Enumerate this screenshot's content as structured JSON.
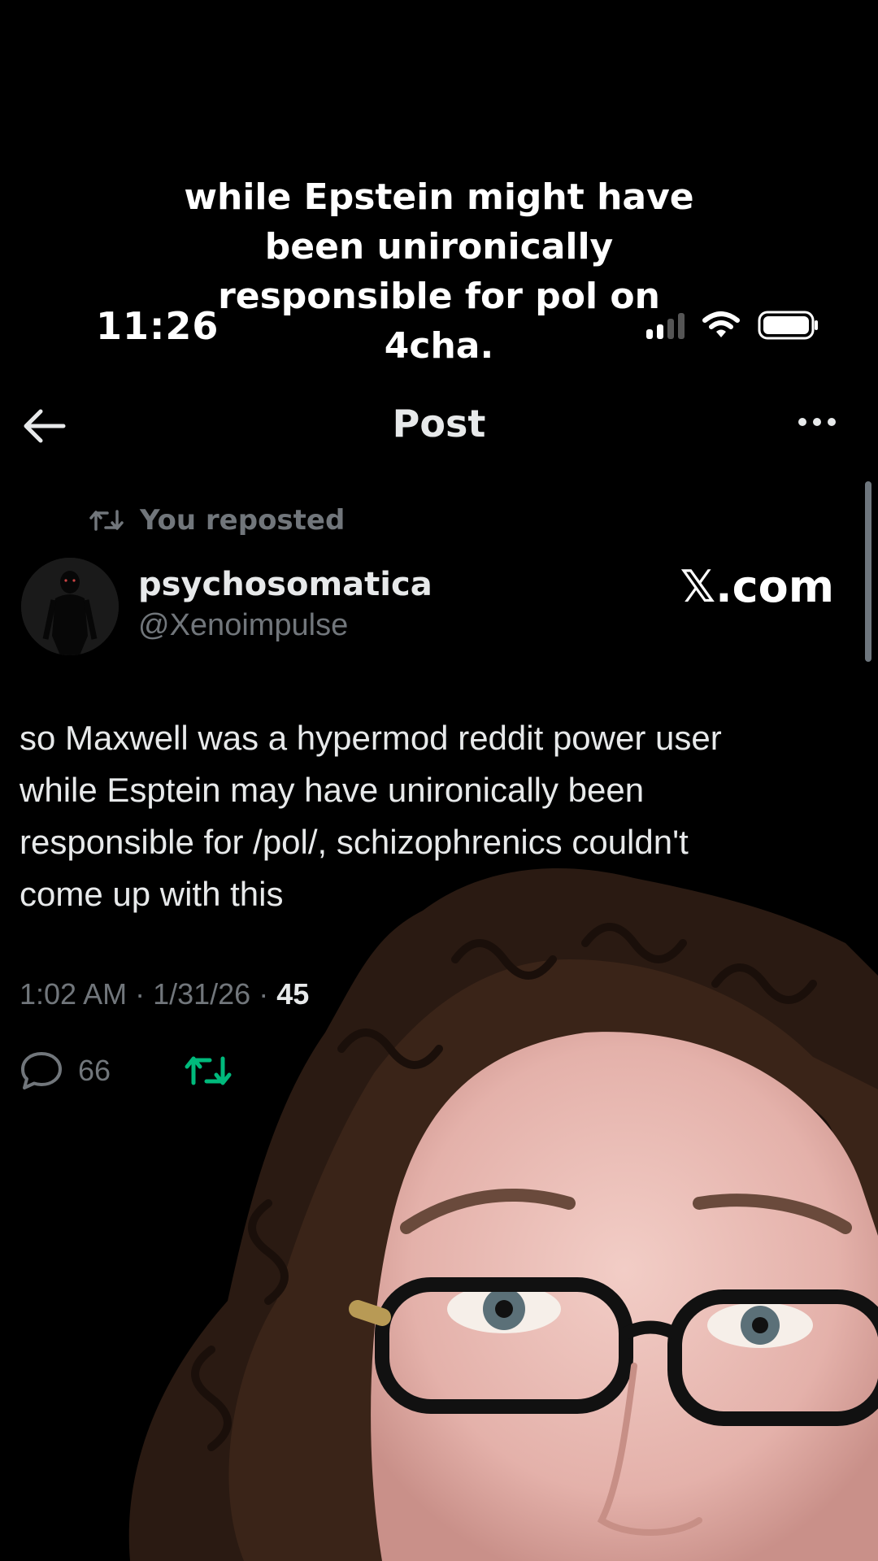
{
  "caption": {
    "lines": [
      "while Epstein might have",
      "been unironically",
      "responsible for pol on",
      "4cha."
    ]
  },
  "status_bar": {
    "time": "11:26"
  },
  "nav": {
    "title": "Post"
  },
  "post": {
    "repost_label": "You reposted",
    "display_name": "psychosomatica",
    "handle": "@Xenoimpulse",
    "watermark": "𝕏.com",
    "text_lines": [
      "so Maxwell was a hypermod reddit power user",
      "while Esptein may have unironically been",
      "responsible for /pol/, schizophrenics couldn't",
      "come up with this"
    ],
    "timestamp": "1:02 AM · 1/31/26 · ",
    "views_partial": "45",
    "reply_count": "66"
  },
  "colors": {
    "background": "#000000",
    "text_primary": "#e7e9ea",
    "text_secondary": "#71767b",
    "repost_active": "#00ba7c"
  }
}
